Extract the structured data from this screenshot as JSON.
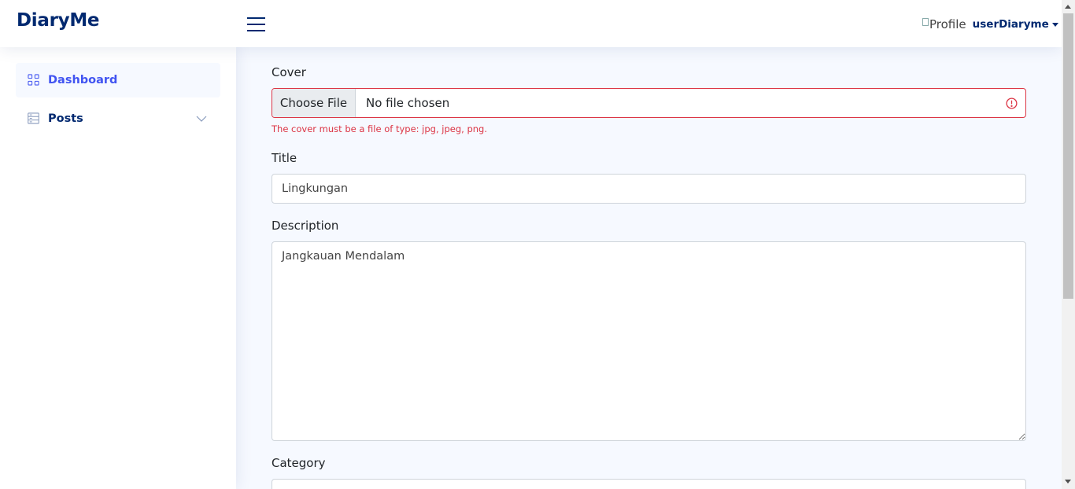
{
  "app": {
    "logo": "DiaryMe"
  },
  "header": {
    "menu_icon": "hamburger-icon",
    "profile_img_alt": "Profile",
    "username": "userDiaryme"
  },
  "sidebar": {
    "items": [
      {
        "label": "Dashboard",
        "icon": "grid-icon",
        "active": true
      },
      {
        "label": "Posts",
        "icon": "posts-icon",
        "expandable": true
      }
    ]
  },
  "form": {
    "cover": {
      "label": "Cover",
      "button_label": "Choose File",
      "file_text": "No file chosen",
      "error": "The cover must be a file of type: jpg, jpeg, png."
    },
    "title": {
      "label": "Title",
      "value": "Lingkungan"
    },
    "description": {
      "label": "Description",
      "value": "Jangkauan Mendalam"
    },
    "category": {
      "label": "Category",
      "value": ""
    }
  },
  "colors": {
    "brand": "#012970",
    "accent": "#4154f1",
    "error": "#dc3545"
  }
}
